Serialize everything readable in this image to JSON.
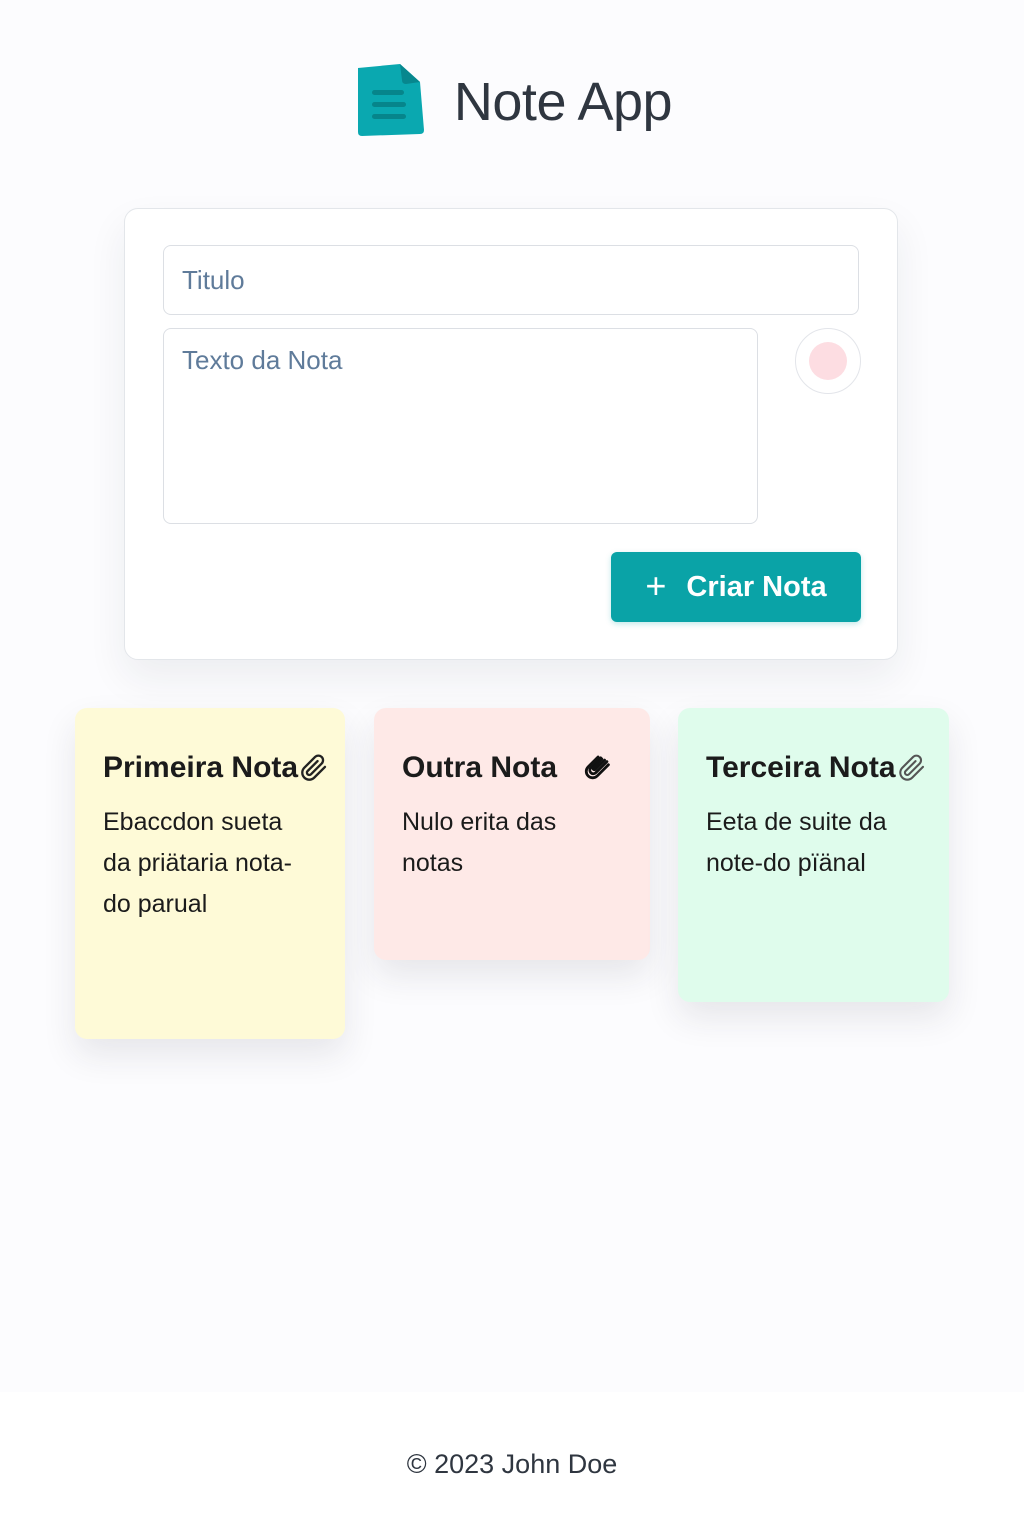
{
  "header": {
    "title": "Note App",
    "logo_icon": "document-icon",
    "logo_color": "#0aa3a7"
  },
  "form": {
    "title_placeholder": "Titulo",
    "text_placeholder": "Texto da Nota",
    "selected_color": "#fddde2",
    "create_button_label": "Criar Nota",
    "create_button_icon": "plus-icon",
    "accent_color": "#0aa3a7"
  },
  "notes": [
    {
      "title": "Primeira Nota",
      "text": "Ebaccdon sueta da priätaria nota-do parual",
      "color": "#fefad7",
      "icon": "paperclip-icon"
    },
    {
      "title": "Outra Nota",
      "text": "Nulo erita das notas",
      "color": "#fee9e7",
      "icon": "paperclip-icon"
    },
    {
      "title": "Terceira Nota",
      "text": "Eeta de suite da note-do pïänal",
      "color": "#dffcec",
      "icon": "paperclip-icon"
    }
  ],
  "footer": {
    "text": "© 2023 John Doe"
  }
}
